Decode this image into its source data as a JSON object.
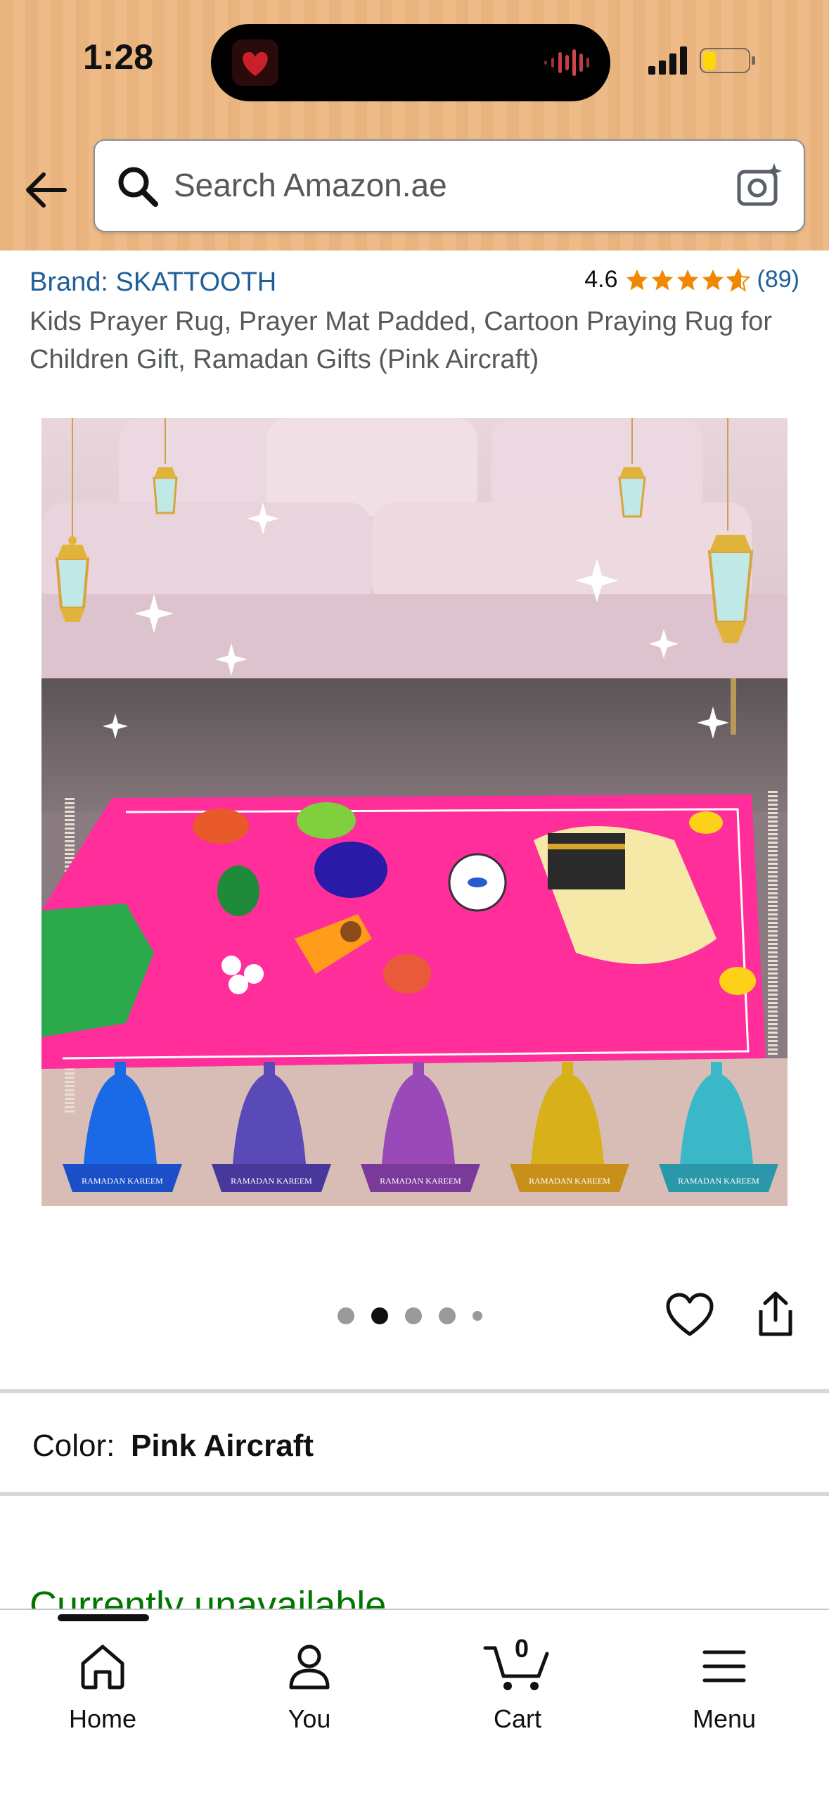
{
  "status_bar": {
    "time": "1:28"
  },
  "search": {
    "placeholder": "Search Amazon.ae"
  },
  "product": {
    "brand": "Brand: SKATTOOTH",
    "rating": "4.6",
    "rating_stars": 4.6,
    "review_count": "(89)",
    "title": "Kids Prayer Rug, Prayer Mat Padded, Cartoon Praying Rug for Children Gift, Ramadan Gifts (Pink Aircraft)",
    "image_badges": [
      "RAMADAN KAREEM",
      "RAMADAN KAREEM",
      "RAMADAN KAREEM",
      "RAMADAN KAREEM",
      "RAMADAN KAREEM"
    ],
    "image_count": 5,
    "current_image": 2
  },
  "color": {
    "label": "Color:",
    "value": "Pink Aircraft"
  },
  "availability": "Currently unavailable",
  "bottom_nav": {
    "home": "Home",
    "you": "You",
    "cart": "Cart",
    "cart_count": "0",
    "menu": "Menu"
  },
  "colors": {
    "header_bg": "#e9b37e",
    "link": "#1f5f99",
    "star": "#f08804",
    "available_green": "#007600",
    "rug_pink": "#ff2e9a"
  }
}
